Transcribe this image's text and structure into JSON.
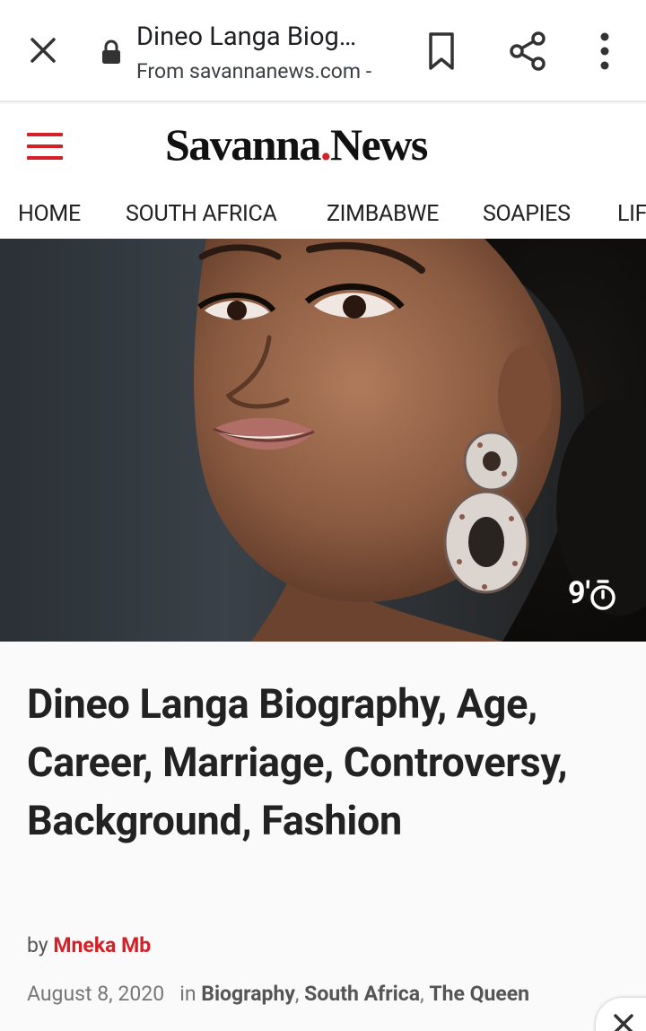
{
  "browser": {
    "title": "Dineo Langa Biog…",
    "url": "From savannanews.com -"
  },
  "site": {
    "logo_part1": "Savanna",
    "logo_dot": ".",
    "logo_part2": "News",
    "accent_color": "#d42027"
  },
  "nav": {
    "items": [
      "HOME",
      "SOUTH AFRICA",
      "ZIMBABWE",
      "SOAPIES",
      "LIF"
    ]
  },
  "hero": {
    "read_time": "9'",
    "read_time_icon": "timer-icon"
  },
  "article": {
    "title": "Dineo Langa Biography, Age, Career, Marriage, Controversy, Background, Fashion",
    "by_label": "by",
    "author": "Mneka Mb",
    "date": "August 8, 2020",
    "in_label": "in",
    "categories": [
      "Biography",
      "South Africa",
      "The Queen"
    ],
    "separator": ","
  }
}
